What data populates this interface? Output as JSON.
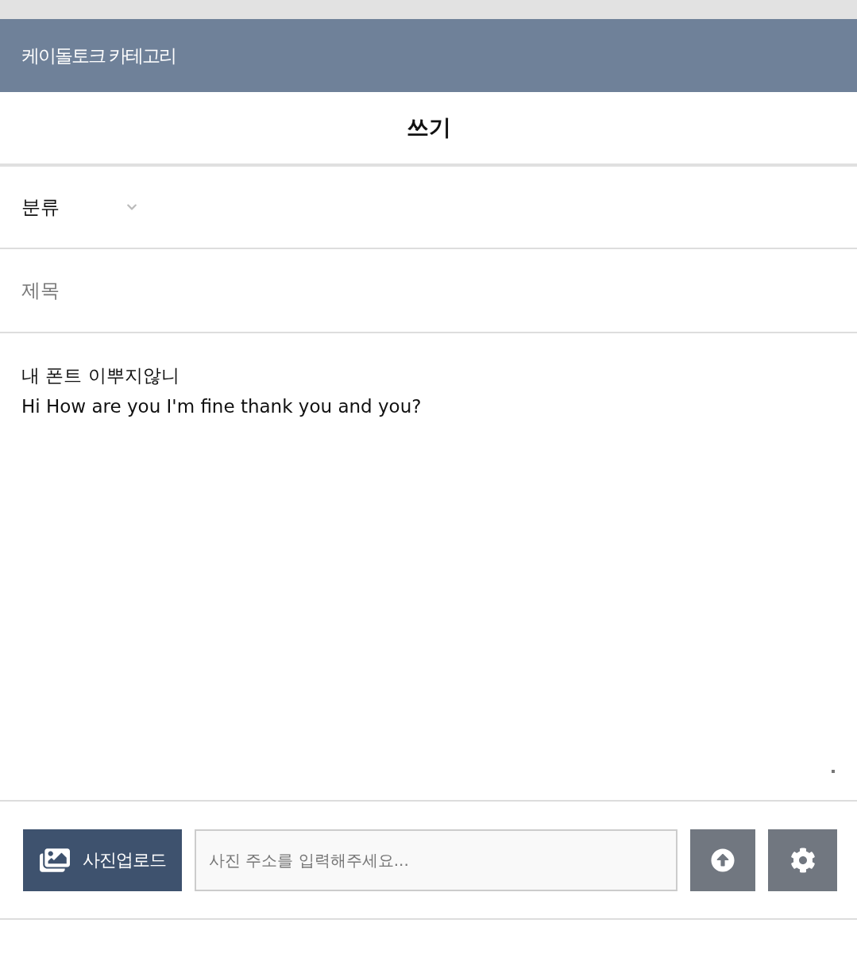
{
  "header": {
    "title": "케이돌토크 카테고리"
  },
  "page_title": "쓰기",
  "category": {
    "label": "분류"
  },
  "subject": {
    "placeholder": "제목"
  },
  "body": {
    "lines": [
      "내 폰트 이뿌지않니",
      "Hi How are you I'm fine thank you and you?"
    ]
  },
  "toolbar": {
    "upload_label": "사진업로드",
    "url_placeholder": "사진 주소를 입력해주세요..."
  }
}
